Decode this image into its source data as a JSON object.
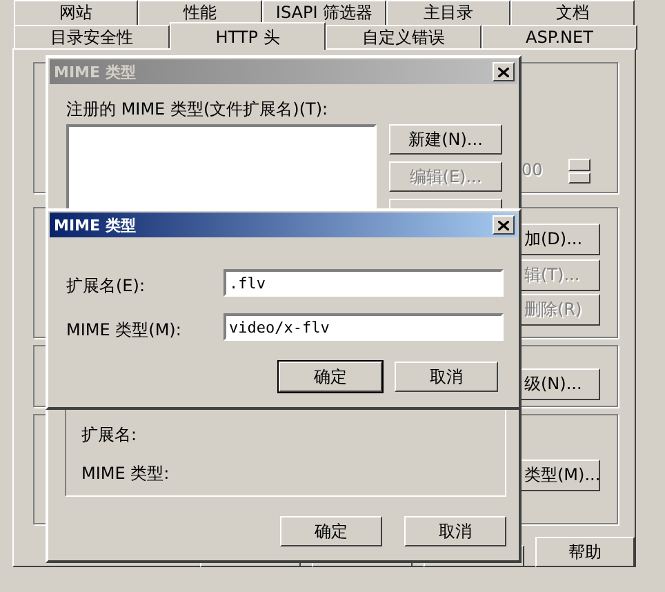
{
  "property_sheet": {
    "tabs_row_1": [
      {
        "label": "网站",
        "selected": false
      },
      {
        "label": "性能",
        "selected": false
      },
      {
        "label": "ISAPI 筛选器",
        "selected": false
      },
      {
        "label": "主目录",
        "selected": false
      },
      {
        "label": "文档",
        "selected": false
      }
    ],
    "tabs_row_2": [
      {
        "label": "目录安全性",
        "selected": false
      },
      {
        "label": "HTTP 头",
        "selected": true
      },
      {
        "label": "自定义错误",
        "selected": false
      },
      {
        "label": "ASP.NET",
        "selected": false
      }
    ],
    "spinner": {
      "value": "00",
      "disabled": true
    },
    "partial_buttons": [
      {
        "label": "加(D)...",
        "disabled": false
      },
      {
        "label": "辑(T)...",
        "disabled": true
      },
      {
        "label": "删除(R)",
        "disabled": true
      },
      {
        "label": "级(N)...",
        "disabled": false
      },
      {
        "label": "类型(M)...",
        "disabled": false
      }
    ],
    "help_button": "帮助"
  },
  "mime_types_dialog": {
    "title": "MIME 类型",
    "active": false,
    "list_label": "注册的 MIME 类型(文件扩展名)(T):",
    "buttons": [
      {
        "label": "新建(N)...",
        "disabled": false
      },
      {
        "label": "编辑(E)...",
        "disabled": true
      }
    ],
    "details": {
      "extension_label": "扩展名:",
      "mime_label": "MIME 类型:"
    },
    "ok": "确定",
    "cancel": "取消"
  },
  "mime_type_dialog": {
    "title": "MIME 类型",
    "active": true,
    "extension": {
      "label": "扩展名(E):",
      "value": ".flv"
    },
    "mime_type": {
      "label": "MIME 类型(M):",
      "value": "video/x-flv"
    },
    "ok": "确定",
    "cancel": "取消"
  }
}
